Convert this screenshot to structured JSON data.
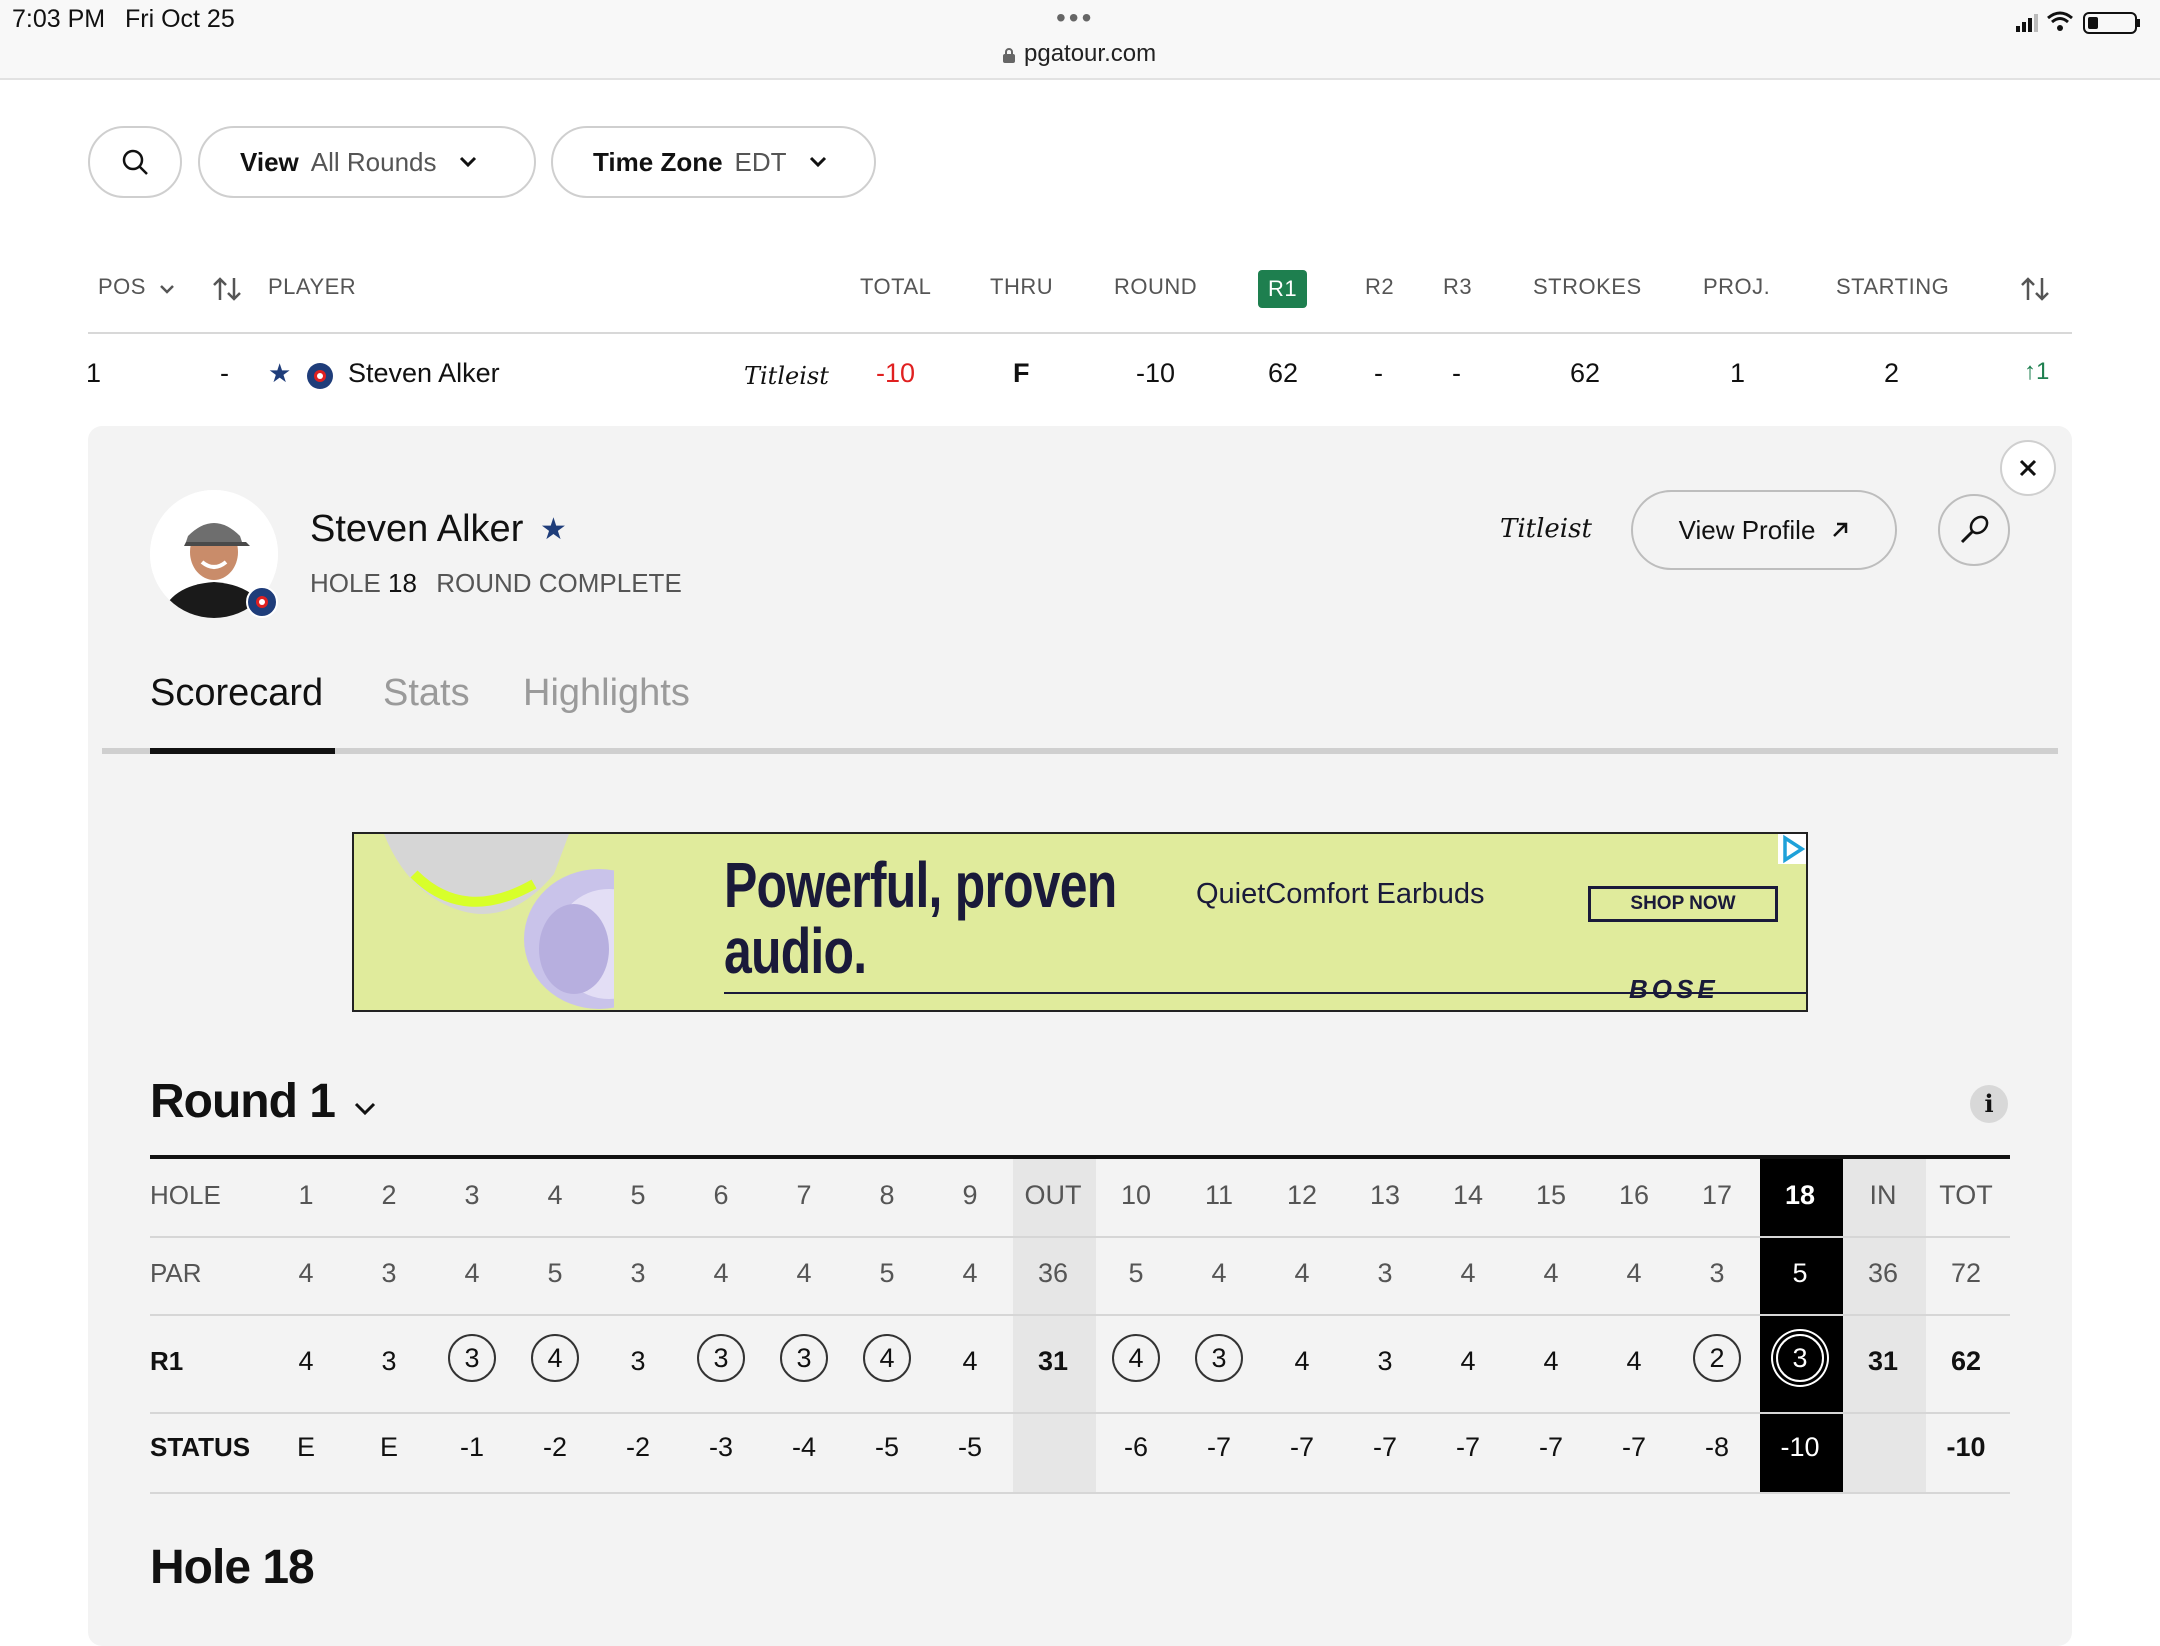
{
  "status_bar": {
    "time": "7:03 PM",
    "date": "Fri Oct 25",
    "dots": "•••",
    "url": "pgatour.com"
  },
  "filters": {
    "search_icon": "search-icon",
    "view_label": "View",
    "view_value": "All Rounds",
    "timezone_label": "Time Zone",
    "timezone_value": "EDT"
  },
  "leaderboard": {
    "headers": {
      "pos": "POS",
      "player": "PLAYER",
      "total": "TOTAL",
      "thru": "THRU",
      "round": "ROUND",
      "r1": "R1",
      "r2": "R2",
      "r3": "R3",
      "strokes": "STROKES",
      "proj": "PROJ.",
      "starting": "STARTING"
    },
    "row": {
      "pos": "1",
      "movement": "-",
      "player": "Steven Alker",
      "sponsor": "Titleist",
      "total": "-10",
      "thru": "F",
      "round": "-10",
      "r1": "62",
      "r2": "-",
      "r3": "-",
      "strokes": "62",
      "proj": "1",
      "starting": "2",
      "change": "↑1"
    },
    "colors": {
      "accent_green": "#1e7f4f",
      "negative_red": "#e02020",
      "star_blue": "#1f3d7a"
    }
  },
  "player_panel": {
    "name": "Steven Alker",
    "hole_label": "HOLE",
    "hole_value": "18",
    "status": "ROUND COMPLETE",
    "sponsor": "Titleist",
    "view_profile": "View Profile",
    "tabs": [
      "Scorecard",
      "Stats",
      "Highlights"
    ],
    "active_tab": "Scorecard"
  },
  "ad": {
    "headline_1": "Powerful, proven",
    "headline_2": "audio.",
    "product": "QuietComfort Earbuds",
    "cta": "SHOP NOW",
    "brand": "BOSE"
  },
  "scorecard": {
    "round_title": "Round 1",
    "row_labels": [
      "HOLE",
      "PAR",
      "R1",
      "STATUS"
    ],
    "holes": [
      "1",
      "2",
      "3",
      "4",
      "5",
      "6",
      "7",
      "8",
      "9",
      "OUT",
      "10",
      "11",
      "12",
      "13",
      "14",
      "15",
      "16",
      "17",
      "18",
      "IN",
      "TOT"
    ],
    "par": [
      "4",
      "3",
      "4",
      "5",
      "3",
      "4",
      "4",
      "5",
      "4",
      "36",
      "5",
      "4",
      "4",
      "3",
      "4",
      "4",
      "4",
      "3",
      "5",
      "36",
      "72"
    ],
    "r1": [
      "4",
      "3",
      "3",
      "4",
      "3",
      "3",
      "3",
      "4",
      "4",
      "31",
      "4",
      "3",
      "4",
      "3",
      "4",
      "4",
      "4",
      "2",
      "3",
      "31",
      "62"
    ],
    "r1_circled": [
      false,
      false,
      true,
      true,
      false,
      true,
      true,
      true,
      false,
      false,
      true,
      true,
      false,
      false,
      false,
      false,
      false,
      true,
      true,
      false,
      false
    ],
    "status": [
      "E",
      "E",
      "-1",
      "-2",
      "-2",
      "-3",
      "-4",
      "-5",
      "-5",
      "",
      "-6",
      "-7",
      "-7",
      "-7",
      "-7",
      "-7",
      "-7",
      "-8",
      "-10",
      "",
      "-10"
    ]
  },
  "next_section": {
    "title": "Hole 18"
  }
}
